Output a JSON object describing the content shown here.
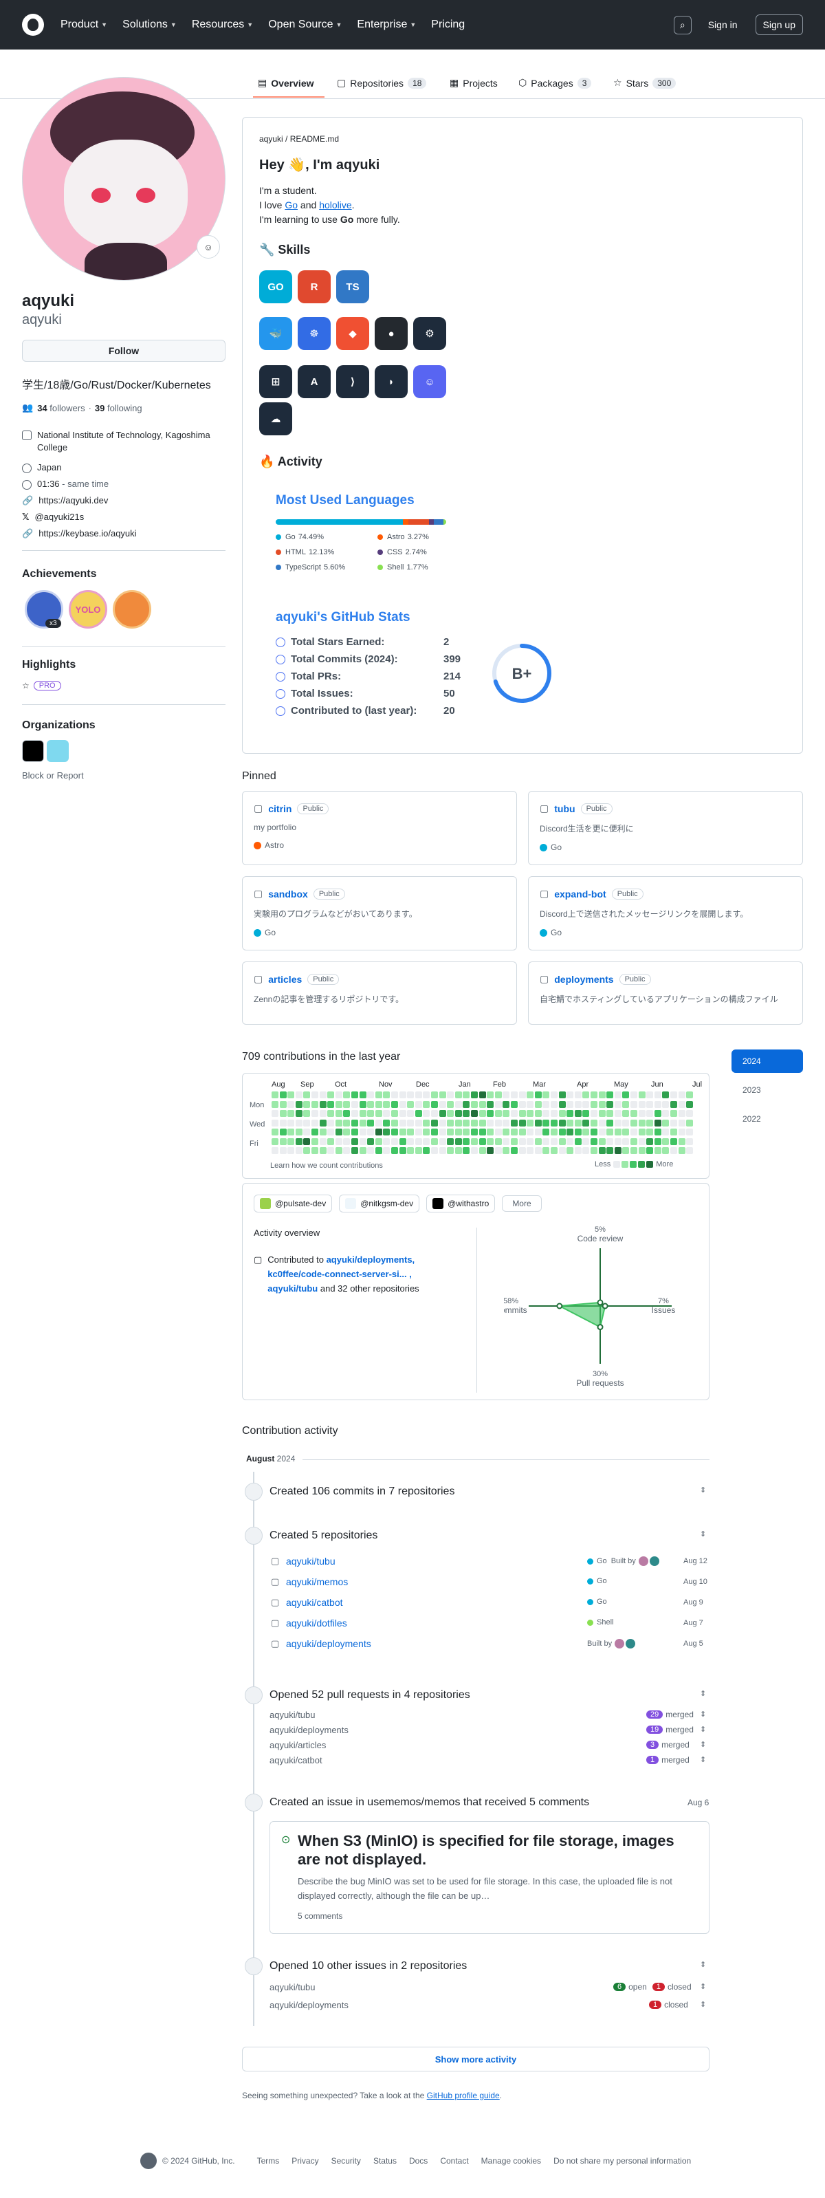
{
  "nav": {
    "items": [
      "Product",
      "Solutions",
      "Resources",
      "Open Source",
      "Enterprise",
      "Pricing"
    ],
    "sign_in": "Sign in",
    "sign_up": "Sign up"
  },
  "tabs": {
    "overview": "Overview",
    "repositories": "Repositories",
    "repositories_count": "18",
    "projects": "Projects",
    "packages": "Packages",
    "packages_count": "3",
    "stars": "Stars",
    "stars_count": "300"
  },
  "profile": {
    "name": "aqyuki",
    "login": "aqyuki",
    "follow": "Follow",
    "bio": "学生/18歳/Go/Rust/Docker/Kubernetes",
    "followers": "34",
    "followers_label": "followers",
    "following": "39",
    "following_label": "following",
    "org": "National Institute of Technology, Kagoshima College",
    "location": "Japan",
    "time": "01:36",
    "time_note": "- same time",
    "website": "https://aqyuki.dev",
    "x": "@aqyuki21s",
    "keybase": "https://keybase.io/aqyuki",
    "achievements": "Achievements",
    "achievement_badge": "x3",
    "highlights": "Highlights",
    "pro": "PRO",
    "organizations": "Organizations",
    "block": "Block or Report"
  },
  "readme": {
    "path_user": "aqyuki",
    "path_file": "README.md",
    "greeting": "Hey 👋, I'm aqyuki",
    "line1": "I'm a student.",
    "line2_a": "I love ",
    "line2_go": "Go",
    "line2_b": " and ",
    "line2_holo": "hololive",
    "line2_c": ".",
    "line3_a": "I'm learning to use ",
    "line3_b": "Go",
    "line3_c": " more fully.",
    "skills_title": "🔧 Skills",
    "activity_title": "🔥 Activity",
    "skills": [
      {
        "label": "GO",
        "color": "#00ACD7"
      },
      {
        "label": "R",
        "color": "#E0492F"
      },
      {
        "label": "TS",
        "color": "#3178C6"
      },
      {
        "label": "🐳",
        "color": "#2496ED"
      },
      {
        "label": "☸",
        "color": "#326CE5"
      },
      {
        "label": "◆",
        "color": "#F05032"
      },
      {
        "label": "●",
        "color": "#24292f"
      },
      {
        "label": "⚙",
        "color": "#1e2b3b"
      },
      {
        "label": "⊞",
        "color": "#1e2b3b"
      },
      {
        "label": "A",
        "color": "#1e2b3b"
      },
      {
        "label": "⟩",
        "color": "#1e2b3b"
      },
      {
        "label": "◗",
        "color": "#1e2b3b"
      },
      {
        "label": "☺",
        "color": "#5865F2"
      },
      {
        "label": "☁",
        "color": "#1e2b3b"
      }
    ],
    "lang_title": "Most Used Languages",
    "languages": [
      {
        "name": "Go",
        "pct": "74.49%",
        "value": 74.49,
        "color": "#00ADD8"
      },
      {
        "name": "Astro",
        "pct": "3.27%",
        "value": 3.27,
        "color": "#ff5a03"
      },
      {
        "name": "HTML",
        "pct": "12.13%",
        "value": 12.13,
        "color": "#e34c26"
      },
      {
        "name": "CSS",
        "pct": "2.74%",
        "value": 2.74,
        "color": "#563d7c"
      },
      {
        "name": "TypeScript",
        "pct": "5.60%",
        "value": 5.6,
        "color": "#3178c6"
      },
      {
        "name": "Shell",
        "pct": "1.77%",
        "value": 1.77,
        "color": "#89e051"
      }
    ],
    "stats_title": "aqyuki's GitHub Stats",
    "stats": [
      {
        "label": "Total Stars Earned:",
        "value": "2"
      },
      {
        "label": "Total Commits (2024):",
        "value": "399"
      },
      {
        "label": "Total PRs:",
        "value": "214"
      },
      {
        "label": "Total Issues:",
        "value": "50"
      },
      {
        "label": "Contributed to (last year):",
        "value": "20"
      }
    ],
    "grade": "B+",
    "grade_progress": 0.7
  },
  "pinned": {
    "title": "Pinned",
    "public": "Public",
    "items": [
      {
        "name": "citrin",
        "desc": "my portfolio",
        "lang": "Astro",
        "color": "#ff5a03"
      },
      {
        "name": "tubu",
        "desc": "Discord生活を更に便利に",
        "lang": "Go",
        "color": "#00ADD8"
      },
      {
        "name": "sandbox",
        "desc": "実験用のプログラムなどがおいてあります。",
        "lang": "Go",
        "color": "#00ADD8"
      },
      {
        "name": "expand-bot",
        "desc": "Discord上で送信されたメッセージリンクを展開します。",
        "lang": "Go",
        "color": "#00ADD8"
      },
      {
        "name": "articles",
        "desc": "Zennの記事を管理するリポジトリです。",
        "lang": "",
        "color": ""
      },
      {
        "name": "deployments",
        "desc": "自宅鯖でホスティングしているアプリケーションの構成ファイル",
        "lang": "",
        "color": ""
      }
    ]
  },
  "contrib": {
    "title": "709 contributions in the last year",
    "months": [
      "Aug",
      "Sep",
      "Oct",
      "Nov",
      "Dec",
      "Jan",
      "Feb",
      "Mar",
      "Apr",
      "May",
      "Jun",
      "Jul"
    ],
    "days": [
      "Mon",
      "Wed",
      "Fri"
    ],
    "learn": "Learn how we count contributions",
    "less": "Less",
    "more": "More",
    "years": [
      "2024",
      "2023",
      "2022"
    ],
    "orgs": [
      "@pulsate-dev",
      "@nitkgsm-dev",
      "@withastro"
    ],
    "orgs_more": "More",
    "overview_title": "Activity overview",
    "contributed_to": "Contributed to ",
    "repos_line": "aqyuki/deployments, kc0ffee/code-connect-server-si... , aqyuki/tubu",
    "others": " and 32 other repositories",
    "radar": {
      "code_review": "Code review",
      "code_review_pct": "5%",
      "issues": "Issues",
      "issues_pct": "7%",
      "prs": "Pull requests",
      "prs_pct": "30%",
      "commits": "Commits",
      "commits_pct": "58%"
    }
  },
  "activity": {
    "title": "Contribution activity",
    "month": "August",
    "year": "2024",
    "commits": "Created 106 commits in 7 repositories",
    "repos_title": "Created 5 repositories",
    "repos": [
      {
        "name": "aqyuki/tubu",
        "lang": "Go",
        "built": "Built by",
        "date": "Aug 12",
        "color": "#00ADD8"
      },
      {
        "name": "aqyuki/memos",
        "lang": "Go",
        "built": "",
        "date": "Aug 10",
        "color": "#00ADD8"
      },
      {
        "name": "aqyuki/catbot",
        "lang": "Go",
        "built": "",
        "date": "Aug 9",
        "color": "#00ADD8"
      },
      {
        "name": "aqyuki/dotfiles",
        "lang": "Shell",
        "built": "",
        "date": "Aug 7",
        "color": "#89e051"
      },
      {
        "name": "aqyuki/deployments",
        "lang": "",
        "built": "Built by",
        "date": "Aug 5",
        "color": ""
      }
    ],
    "prs_title": "Opened 52 pull requests in 4 repositories",
    "prs": [
      {
        "name": "aqyuki/tubu",
        "count": "29",
        "state": "merged"
      },
      {
        "name": "aqyuki/deployments",
        "count": "19",
        "state": "merged"
      },
      {
        "name": "aqyuki/articles",
        "count": "3",
        "state": "merged"
      },
      {
        "name": "aqyuki/catbot",
        "count": "1",
        "state": "merged"
      }
    ],
    "issue_title": "Created an issue in usememos/memos that received 5 comments",
    "issue_date": "Aug 6",
    "issue_heading": "When S3 (MinIO) is specified for file storage, images are not displayed.",
    "issue_body": "Describe the bug MinIO was set to be used for file storage. In this case, the uploaded file is not displayed correctly, although the file can be up…",
    "issue_comments": "5 comments",
    "other_title": "Opened 10 other issues in 2 repositories",
    "other": [
      {
        "name": "aqyuki/tubu",
        "open": "6",
        "open_label": "open",
        "closed": "1",
        "closed_label": "closed"
      },
      {
        "name": "aqyuki/deployments",
        "open": "",
        "open_label": "",
        "closed": "1",
        "closed_label": "closed"
      }
    ],
    "show_more": "Show more activity",
    "unexpected": "Seeing something unexpected? Take a look at the ",
    "guide": "GitHub profile guide",
    "unexpected_end": "."
  },
  "footer": {
    "copy": "© 2024 GitHub, Inc.",
    "links": [
      "Terms",
      "Privacy",
      "Security",
      "Status",
      "Docs",
      "Contact",
      "Manage cookies",
      "Do not share my personal information"
    ]
  },
  "colors": {
    "accent": "#0969da",
    "green1": "#9be9a8",
    "green2": "#40c463",
    "green3": "#30a14e",
    "green4": "#216e39",
    "empty": "#ebedf0",
    "merged": "#8250df",
    "open": "#1a7f37",
    "closed": "#cf222e"
  }
}
